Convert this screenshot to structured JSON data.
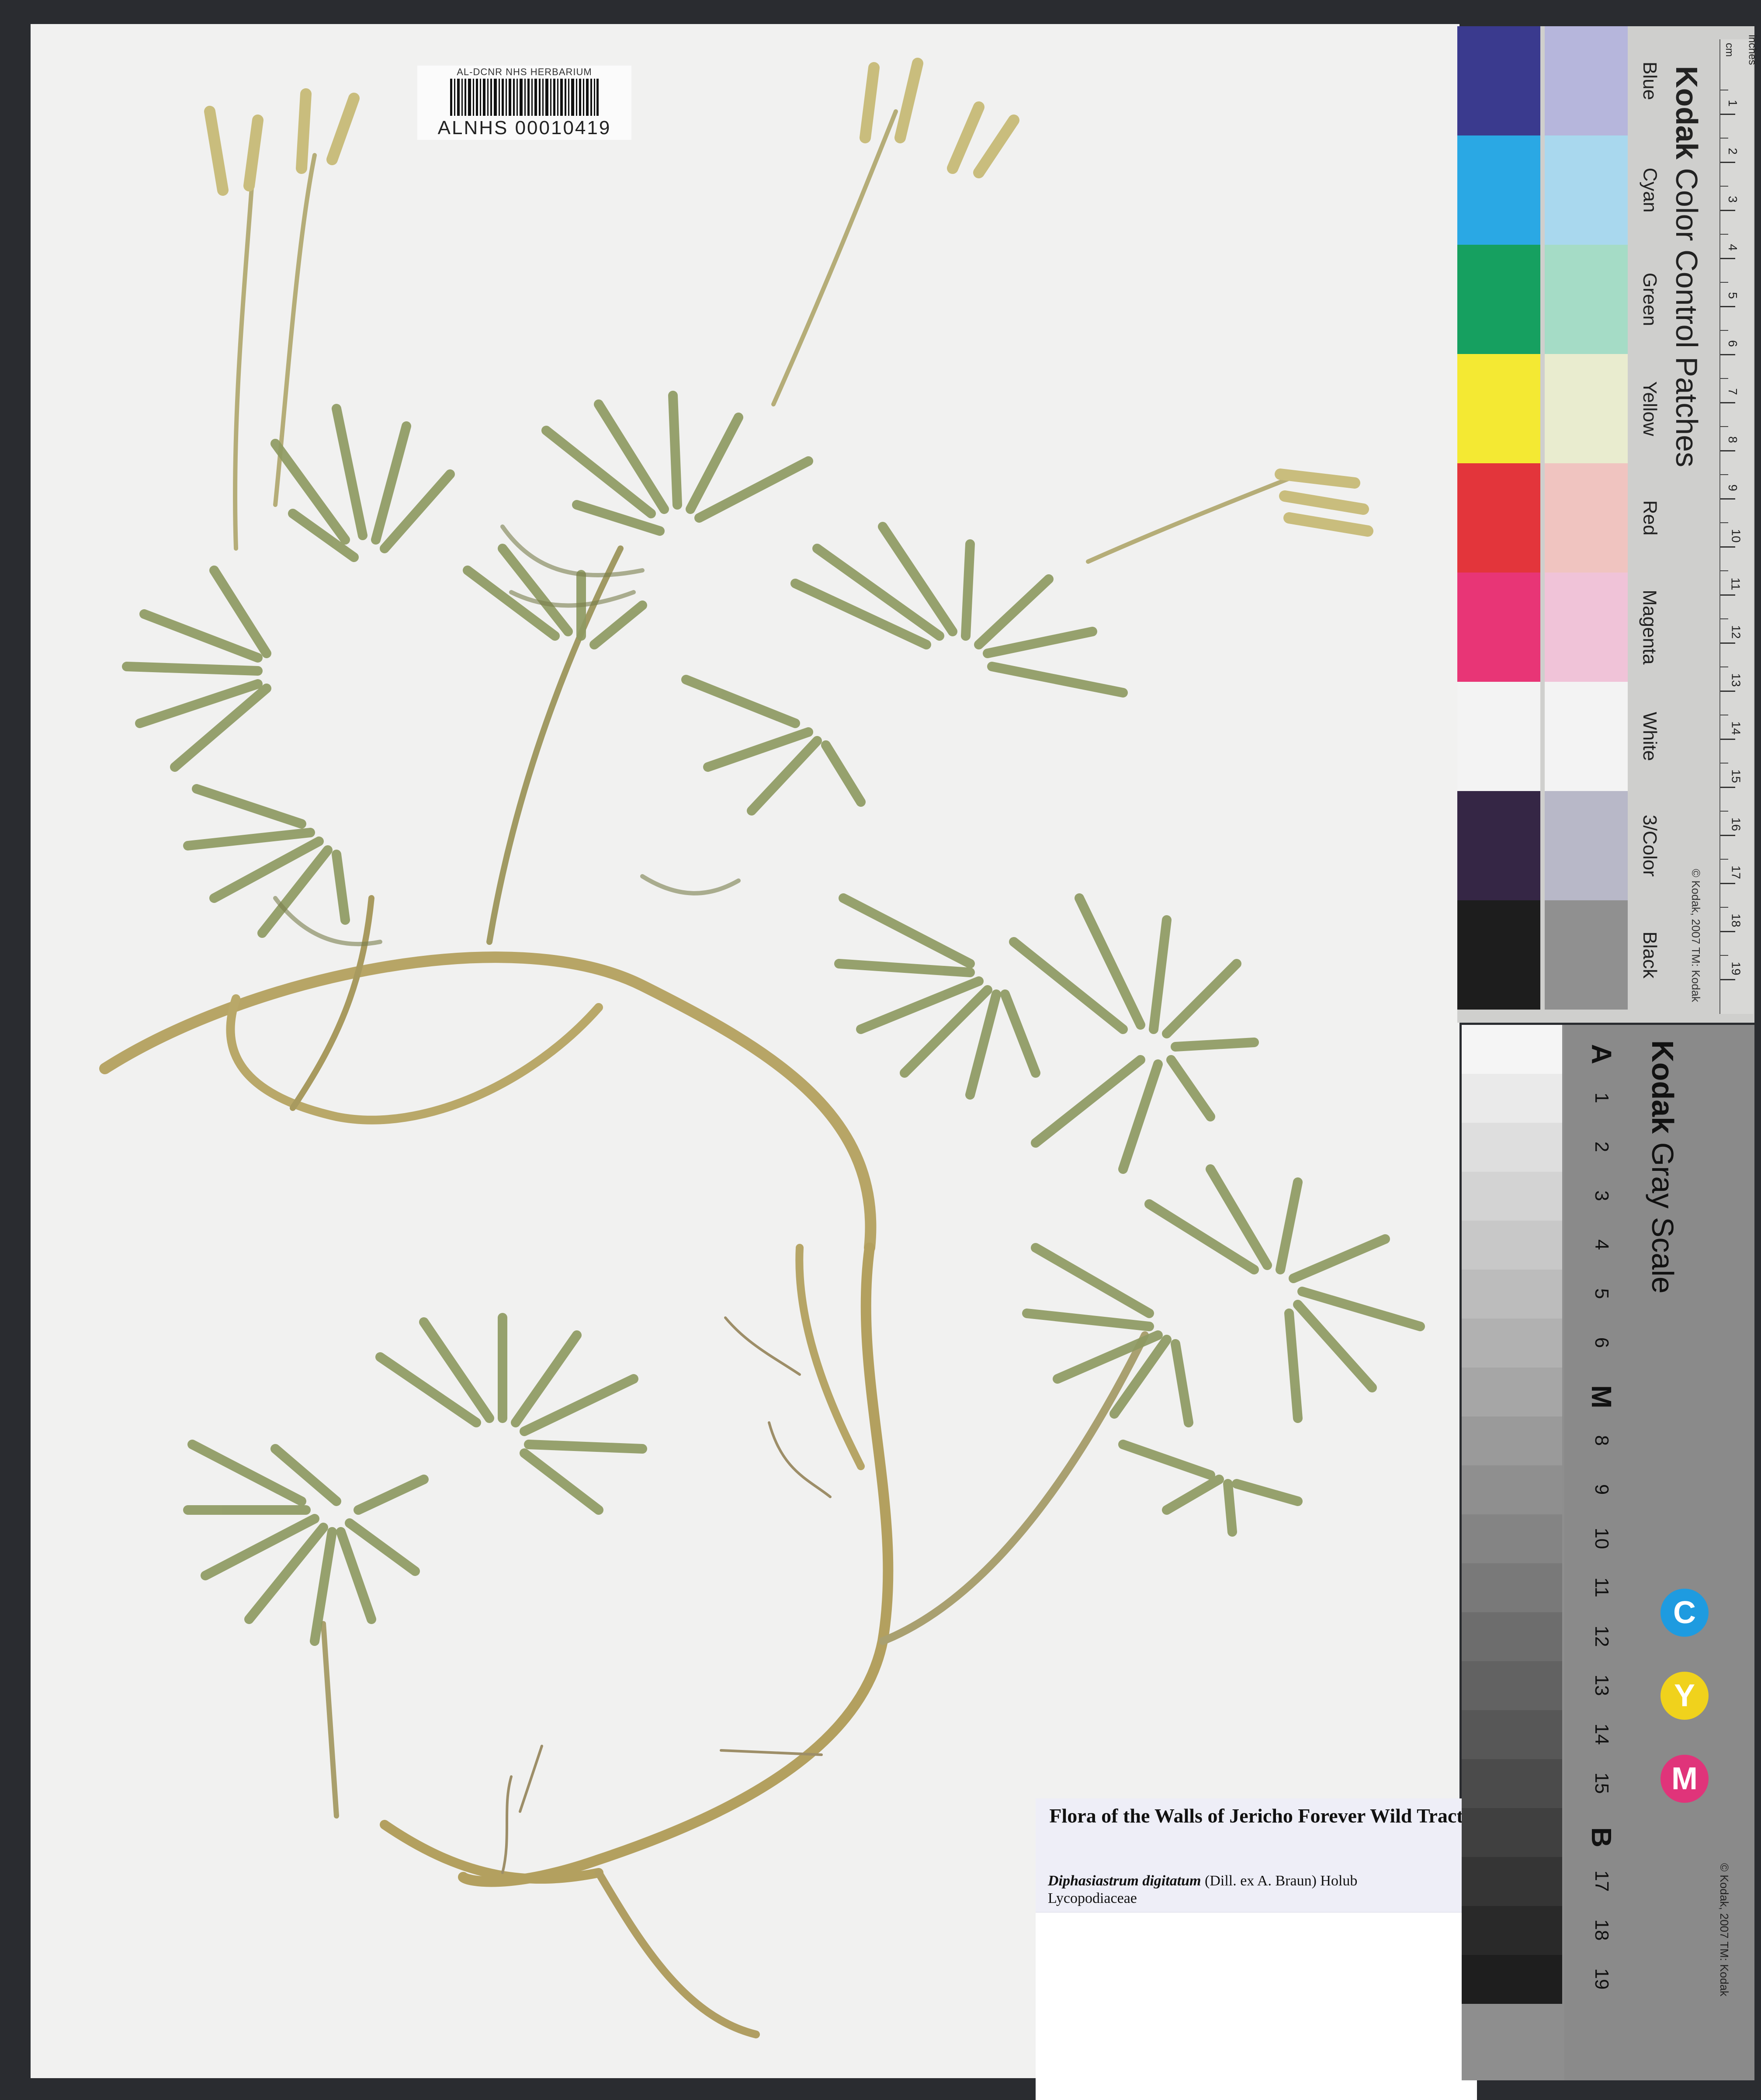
{
  "barcode": {
    "institution": "AL-DCNR NHS HERBARIUM",
    "catalog_number": "ALNHS 00010419"
  },
  "label": {
    "title": "Flora of the Walls of Jericho Forever Wild Tract",
    "taxon_name": "Diphasiastrum digitatum",
    "authority": "(Dill. ex A. Braun) Holub",
    "family": "Lycopodiaceae"
  },
  "color_card": {
    "brand": "Kodak",
    "title": "Color Control Patches",
    "copyright": "© Kodak, 2007 TM: Kodak",
    "ruler_units": [
      "cm",
      "inches"
    ],
    "patches": [
      {
        "name": "Blue",
        "color": "#3a3a8e",
        "tint": "#b6b6dc"
      },
      {
        "name": "Cyan",
        "color": "#2aa8e4",
        "tint": "#a9d8ee"
      },
      {
        "name": "Green",
        "color": "#16a060",
        "tint": "#a5dcc6"
      },
      {
        "name": "Yellow",
        "color": "#f4e933",
        "tint": "#e9eccf"
      },
      {
        "name": "Red",
        "color": "#e3353b",
        "tint": "#f0c4c0"
      },
      {
        "name": "Magenta",
        "color": "#e83576",
        "tint": "#f0c3d8"
      },
      {
        "name": "White",
        "color": "#f3f3f3",
        "tint": "#f3f3f3"
      },
      {
        "name": "3/Color",
        "color": "#352645",
        "tint": "#b8b8c8"
      },
      {
        "name": "Black",
        "color": "#1d1d1d",
        "tint": "#909090"
      }
    ]
  },
  "gray_card": {
    "brand": "Kodak",
    "title": "Gray Scale",
    "copyright": "© Kodak, 2007 TM: Kodak",
    "steps": [
      "A",
      "1",
      "2",
      "3",
      "4",
      "5",
      "6",
      "M",
      "8",
      "9",
      "10",
      "11",
      "12",
      "13",
      "14",
      "15",
      "B",
      "17",
      "18",
      "19"
    ],
    "cym": [
      {
        "letter": "C",
        "color": "#1e9be0"
      },
      {
        "letter": "Y",
        "color": "#f0d21c"
      },
      {
        "letter": "M",
        "color": "#e0347a"
      }
    ]
  }
}
